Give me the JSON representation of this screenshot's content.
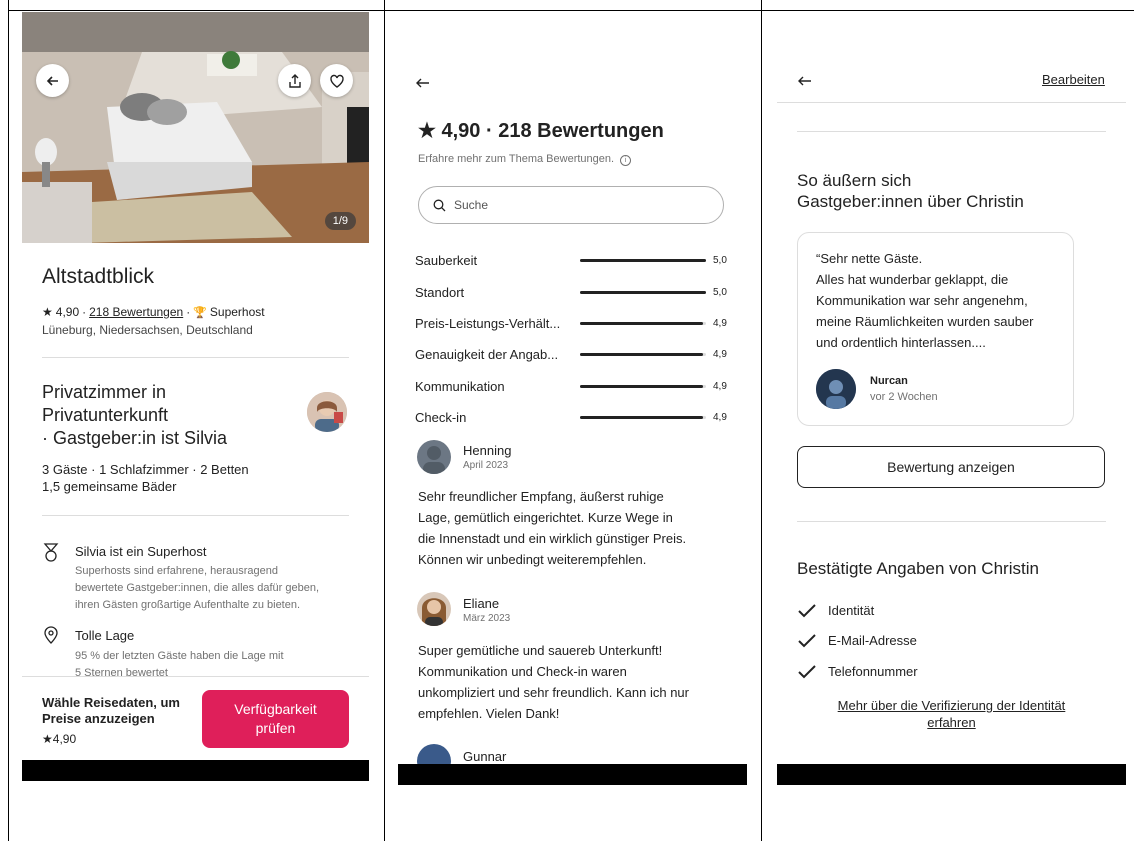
{
  "panel1": {
    "photo": {
      "counter": "1/9"
    },
    "listing_title": "Altstadtblick",
    "rating": "4,90",
    "reviews_link": "218 Bewertungen",
    "superhost_label": "Superhost",
    "location": "Lüneburg, Niedersachsen, Deutschland",
    "room_title_line1": "Privatzimmer in",
    "room_title_line2": "Privatunterkunft",
    "room_title_line3": "· Gastgeber:in ist Silvia",
    "room_details_line1": "3 Gäste · 1 Schlafzimmer · 2 Betten",
    "room_details_line2": "1,5 gemeinsame Bäder",
    "highlights": [
      {
        "title": "Silvia ist ein Superhost",
        "lines": [
          "Superhosts sind erfahrene, herausragend",
          "bewertete Gastgeber:innen, die alles dafür geben,",
          "ihren Gästen großartige Aufenthalte zu bieten."
        ]
      },
      {
        "title": "Tolle Lage",
        "lines": [
          "95 % der letzten Gäste haben die Lage mit",
          "5 Sternen bewertet"
        ]
      }
    ],
    "bottom": {
      "prompt_line1": "Wähle Reisedaten, um",
      "prompt_line2": "Preise anzuzeigen",
      "rating": "4,90",
      "cta_line1": "Verfügbarkeit",
      "cta_line2": "prüfen"
    }
  },
  "panel2": {
    "heading": "4,90 · 218 Bewertungen",
    "subtext": "Erfahre mehr zum Thema Bewertungen.",
    "search_placeholder": "Suche",
    "categories": [
      {
        "name": "Sauberkeit",
        "value": "5,0",
        "fraction": 1.0
      },
      {
        "name": "Standort",
        "value": "5,0",
        "fraction": 1.0
      },
      {
        "name": "Preis-Leistungs-Verhält...",
        "value": "4,9",
        "fraction": 0.98
      },
      {
        "name": "Genauigkeit der Angab...",
        "value": "4,9",
        "fraction": 0.98
      },
      {
        "name": "Kommunikation",
        "value": "4,9",
        "fraction": 0.98
      },
      {
        "name": "Check-in",
        "value": "4,9",
        "fraction": 0.98
      }
    ],
    "reviews": [
      {
        "name": "Henning",
        "date": "April 2023",
        "lines": [
          "Sehr freundlicher Empfang, äußerst ruhige",
          "Lage, gemütlich eingerichtet. Kurze Wege in",
          "die Innenstadt und ein wirklich günstiger Preis.",
          "Können wir unbedingt weiterempfehlen."
        ]
      },
      {
        "name": "Eliane",
        "date": "März 2023",
        "lines": [
          "Super gemütliche und sauereb Unterkunft!",
          "Kommunikation und Check-in waren",
          "unkompliziert und sehr freundlich. Kann ich nur",
          "empfehlen. Vielen Dank!"
        ]
      },
      {
        "name": "Gunnar",
        "date": "",
        "lines": []
      }
    ]
  },
  "panel3": {
    "edit_link": "Bearbeiten",
    "section_title_line1": "So äußern sich",
    "section_title_line2": "Gastgeber:innen über Christin",
    "quote_lines": [
      "“Sehr nette Gäste.",
      "Alles hat wunderbar geklappt, die",
      "Kommunikation war sehr angenehm,",
      "meine Räumlichkeiten wurden sauber",
      "und ordentlich hinterlassen...."
    ],
    "quote_author": "Nurcan",
    "quote_time": "vor 2 Wochen",
    "show_review_button": "Bewertung anzeigen",
    "verified_title": "Bestätigte Angaben von Christin",
    "verified_items": [
      "Identität",
      "E-Mail-Adresse",
      "Telefonnummer"
    ],
    "more_link_line1": "Mehr über die Verifizierung der Identität",
    "more_link_line2": "erfahren"
  },
  "colors": {
    "accent": "#df1f5a",
    "text": "#222222",
    "muted": "#717171",
    "divider": "#dddddd"
  },
  "icons": [
    "back-arrow-icon",
    "share-icon",
    "heart-icon",
    "star-icon",
    "trophy-icon",
    "ribbon-icon",
    "location-pin-icon",
    "search-icon",
    "info-icon",
    "checkmark-icon"
  ]
}
